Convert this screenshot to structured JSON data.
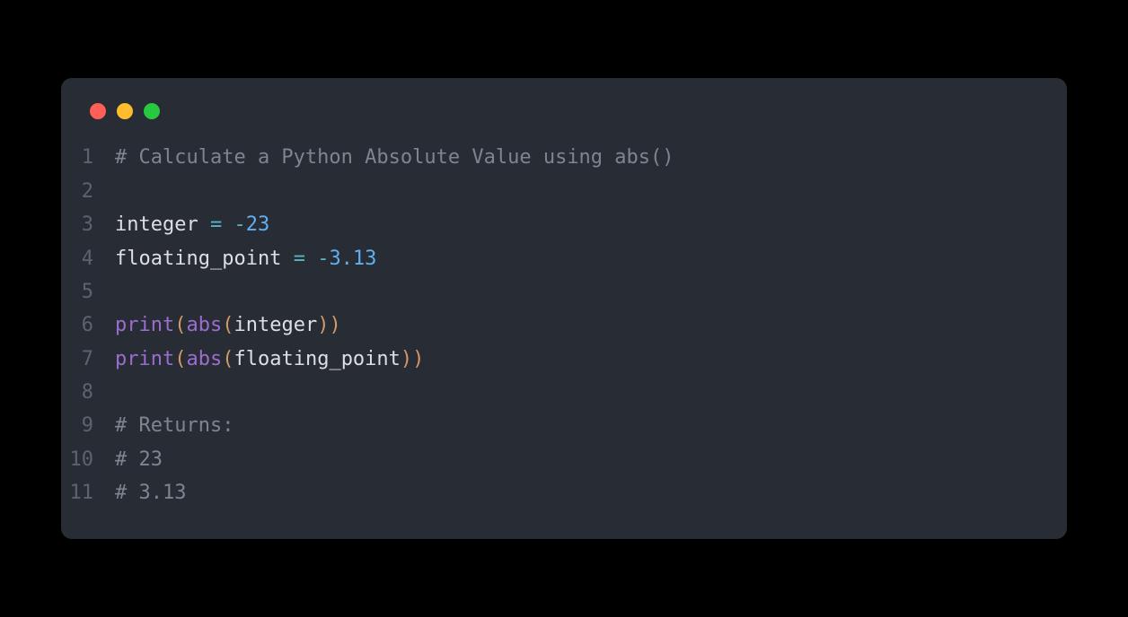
{
  "traffic_lights": {
    "red": "#ff5f56",
    "yellow": "#ffbd2e",
    "green": "#27c93f"
  },
  "code": {
    "lines": [
      {
        "num": "1",
        "tokens": [
          {
            "t": "# Calculate a Python Absolute Value using abs()",
            "c": "tok-comment"
          }
        ]
      },
      {
        "num": "2",
        "tokens": []
      },
      {
        "num": "3",
        "tokens": [
          {
            "t": "integer ",
            "c": "tok-default"
          },
          {
            "t": "=",
            "c": "tok-operator"
          },
          {
            "t": " ",
            "c": "tok-default"
          },
          {
            "t": "-",
            "c": "tok-operator"
          },
          {
            "t": "23",
            "c": "tok-number"
          }
        ]
      },
      {
        "num": "4",
        "tokens": [
          {
            "t": "floating_point ",
            "c": "tok-default"
          },
          {
            "t": "=",
            "c": "tok-operator"
          },
          {
            "t": " ",
            "c": "tok-default"
          },
          {
            "t": "-",
            "c": "tok-operator"
          },
          {
            "t": "3.13",
            "c": "tok-number"
          }
        ]
      },
      {
        "num": "5",
        "tokens": []
      },
      {
        "num": "6",
        "tokens": [
          {
            "t": "print",
            "c": "tok-function"
          },
          {
            "t": "(",
            "c": "tok-paren"
          },
          {
            "t": "abs",
            "c": "tok-builtin"
          },
          {
            "t": "(",
            "c": "tok-paren"
          },
          {
            "t": "integer",
            "c": "tok-default"
          },
          {
            "t": "))",
            "c": "tok-paren"
          }
        ]
      },
      {
        "num": "7",
        "tokens": [
          {
            "t": "print",
            "c": "tok-function"
          },
          {
            "t": "(",
            "c": "tok-paren"
          },
          {
            "t": "abs",
            "c": "tok-builtin"
          },
          {
            "t": "(",
            "c": "tok-paren"
          },
          {
            "t": "floating_point",
            "c": "tok-default"
          },
          {
            "t": "))",
            "c": "tok-paren"
          }
        ]
      },
      {
        "num": "8",
        "tokens": []
      },
      {
        "num": "9",
        "tokens": [
          {
            "t": "# Returns:",
            "c": "tok-comment"
          }
        ]
      },
      {
        "num": "10",
        "tokens": [
          {
            "t": "# 23",
            "c": "tok-comment"
          }
        ]
      },
      {
        "num": "11",
        "tokens": [
          {
            "t": "# 3.13",
            "c": "tok-comment"
          }
        ]
      }
    ]
  }
}
